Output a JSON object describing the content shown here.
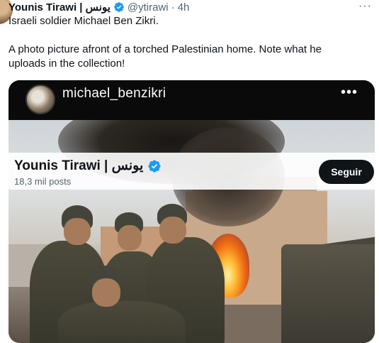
{
  "tweet": {
    "author_name": "Younis Tirawi | يونس",
    "handle": "@ytirawi",
    "separator": "·",
    "time": "4h",
    "more_label": "···",
    "text_line1": "Israeli soldier Michael Ben Zikri.",
    "text_line2": "A photo picture afront of a torched Palestinian home. Note what he uploads in the collection!",
    "verified_icon": "verified-badge-icon",
    "colors": {
      "verified": "#1d9bf0",
      "secondary_text": "#536471"
    }
  },
  "media": {
    "ig_username": "michael_benzikri",
    "ig_more_label": "•••"
  },
  "profile_card": {
    "name": "Younis Tirawi | يونس",
    "posts_count": "18,3 mil posts",
    "follow_label": "Seguir"
  }
}
